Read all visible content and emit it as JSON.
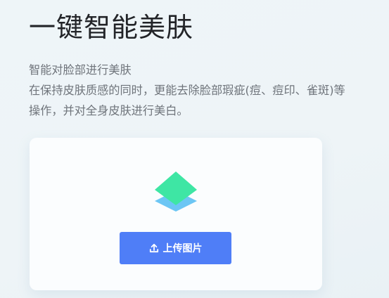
{
  "page": {
    "title": "一键智能美肤",
    "description_lines": [
      "智能对脸部进行美肤",
      "在保持皮肤质感的同时，更能去除脸部瑕疵(痘、痘印、雀斑)等",
      "操作，并对全身皮肤进行美白。"
    ]
  },
  "upload": {
    "icon": "layers-icon",
    "button_icon": "upload-icon",
    "button_label": "上传图片"
  },
  "colors": {
    "accent": "#4f7ef7",
    "icon_top": "#3ee6a4",
    "icon_bottom": "#6cc6f4"
  }
}
